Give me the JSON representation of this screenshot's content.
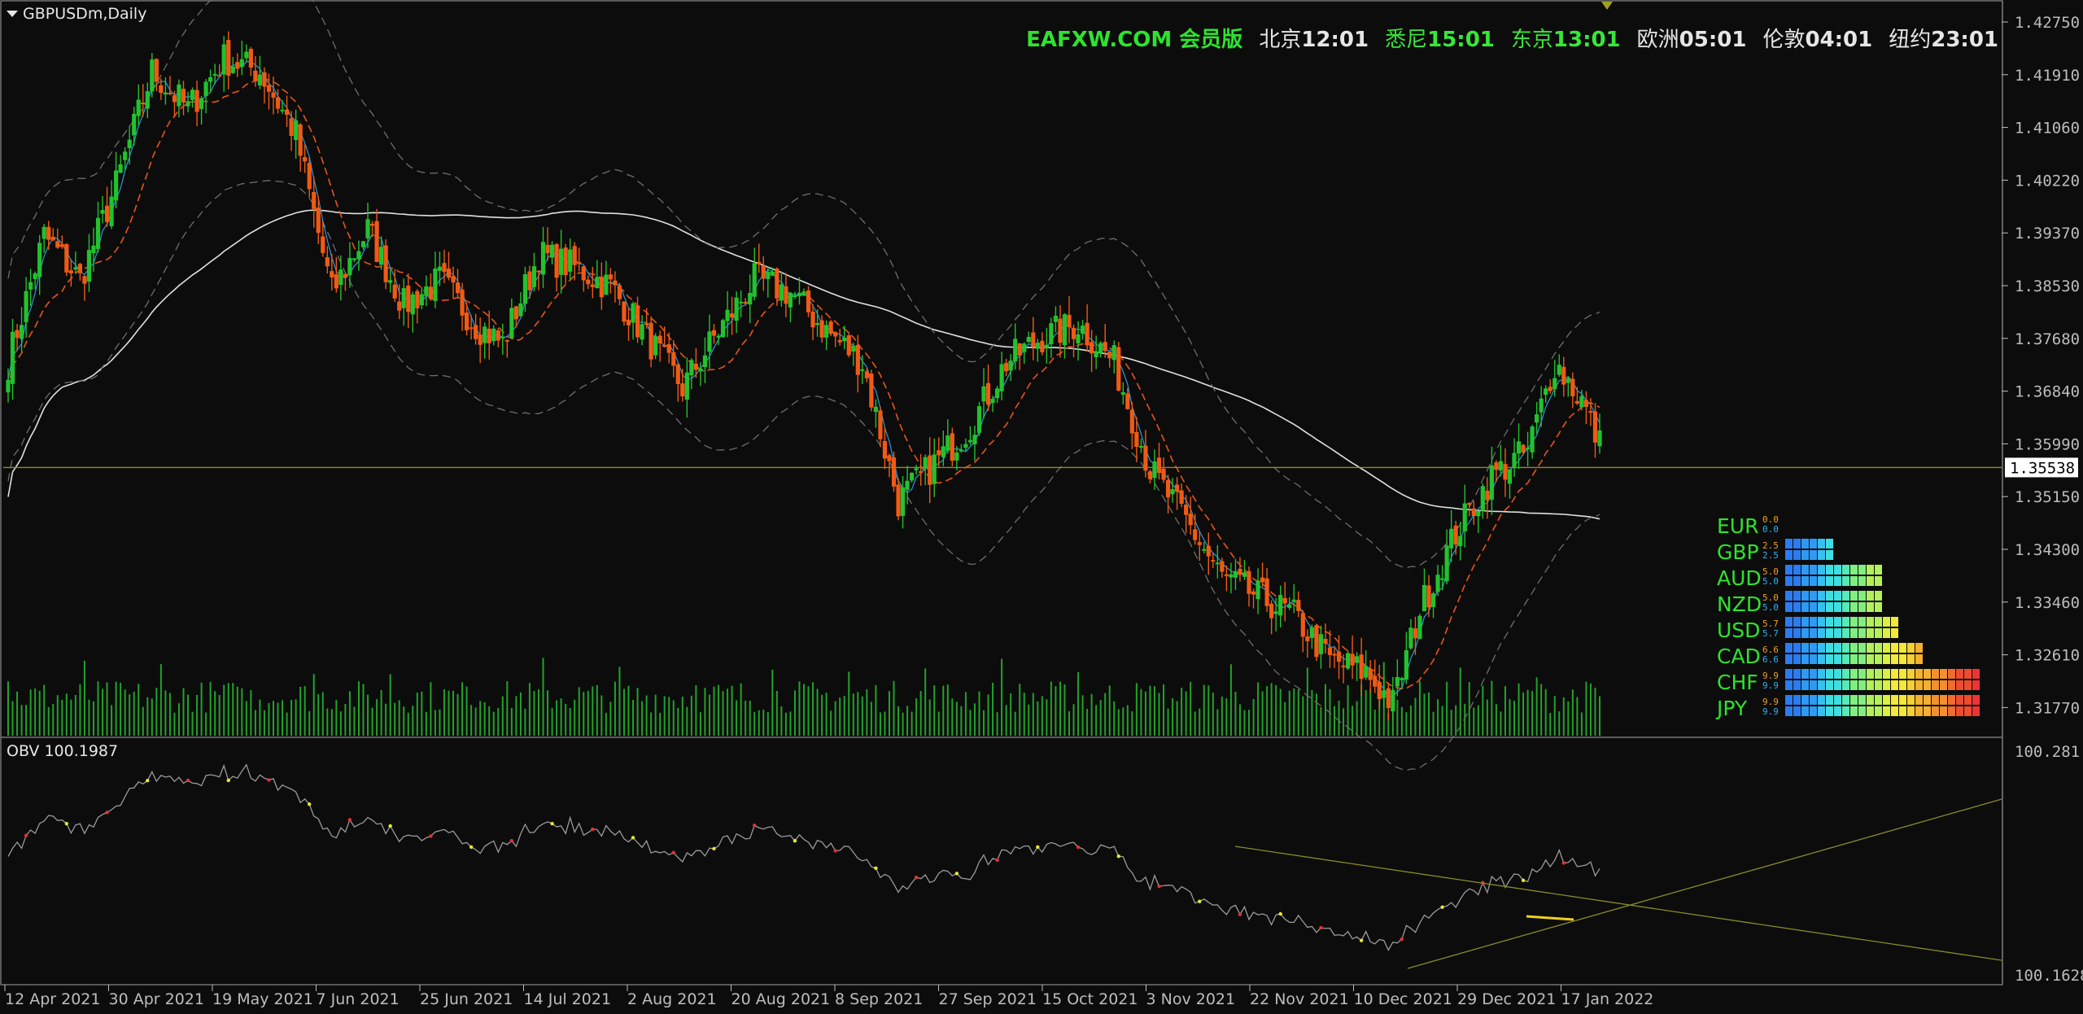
{
  "symbol": {
    "label": "GBPUSDm,Daily"
  },
  "header": {
    "brand": "EAFXW.COM 会员版",
    "clocks": [
      {
        "city": "北京",
        "time": "12:01",
        "color": "#e6e6e6"
      },
      {
        "city": "悉尼",
        "time": "15:01",
        "color": "#38e838"
      },
      {
        "city": "东京",
        "time": "13:01",
        "color": "#38e838"
      },
      {
        "city": "欧洲",
        "time": "05:01",
        "color": "#e6e6e6"
      },
      {
        "city": "伦敦",
        "time": "04:01",
        "color": "#e6e6e6"
      },
      {
        "city": "纽约",
        "time": "23:01",
        "color": "#e6e6e6"
      }
    ]
  },
  "colors": {
    "bull": "#22c22e",
    "bear": "#f05a14",
    "bg": "#0c0c0c",
    "grid_axis": "#bdbdbd",
    "current_line": "#8e8a2a",
    "sma200": "#e0e0e0",
    "ema": "#e8541a",
    "bands": "#6e6e6e",
    "obv_line": "#9a9a9a",
    "volume": "#22a22a"
  },
  "chart_data": [
    {
      "type": "candlestick",
      "title": "GBPUSDm,Daily",
      "price_ticks": [
        "1.42750",
        "1.41910",
        "1.41060",
        "1.40220",
        "1.39370",
        "1.38530",
        "1.37680",
        "1.36840",
        "1.35990",
        "1.35150",
        "1.34300",
        "1.33460",
        "1.32610",
        "1.31770"
      ],
      "current_price": "1.35538",
      "x_ticks": [
        "12 Apr 2021",
        "30 Apr 2021",
        "19 May 2021",
        "7 Jun 2021",
        "25 Jun 2021",
        "14 Jul 2021",
        "2 Aug 2021",
        "20 Aug 2021",
        "8 Sep 2021",
        "27 Sep 2021",
        "15 Oct 2021",
        "3 Nov 2021",
        "22 Nov 2021",
        "10 Dec 2021",
        "29 Dec 2021",
        "17 Jan 2022"
      ],
      "ylim": [
        1.313,
        1.429
      ],
      "path_keypoints": [
        [
          0,
          1.372
        ],
        [
          8,
          1.392
        ],
        [
          16,
          1.385
        ],
        [
          24,
          1.4
        ],
        [
          32,
          1.418
        ],
        [
          40,
          1.412
        ],
        [
          48,
          1.42
        ],
        [
          56,
          1.418
        ],
        [
          64,
          1.408
        ],
        [
          72,
          1.383
        ],
        [
          80,
          1.393
        ],
        [
          88,
          1.381
        ],
        [
          96,
          1.385
        ],
        [
          104,
          1.378
        ],
        [
          110,
          1.375
        ],
        [
          118,
          1.389
        ],
        [
          126,
          1.387
        ],
        [
          134,
          1.384
        ],
        [
          142,
          1.376
        ],
        [
          150,
          1.368
        ],
        [
          158,
          1.377
        ],
        [
          166,
          1.385
        ],
        [
          174,
          1.383
        ],
        [
          182,
          1.377
        ],
        [
          190,
          1.372
        ],
        [
          198,
          1.35
        ],
        [
          206,
          1.356
        ],
        [
          214,
          1.362
        ],
        [
          222,
          1.372
        ],
        [
          230,
          1.376
        ],
        [
          238,
          1.378
        ],
        [
          246,
          1.372
        ],
        [
          254,
          1.355
        ],
        [
          262,
          1.347
        ],
        [
          270,
          1.338
        ],
        [
          278,
          1.335
        ],
        [
          286,
          1.332
        ],
        [
          294,
          1.325
        ],
        [
          302,
          1.323
        ],
        [
          308,
          1.318
        ],
        [
          314,
          1.333
        ],
        [
          322,
          1.345
        ],
        [
          330,
          1.354
        ],
        [
          338,
          1.358
        ],
        [
          344,
          1.372
        ],
        [
          350,
          1.366
        ],
        [
          354,
          1.359
        ]
      ],
      "volume": {
        "type": "bar",
        "note": ""
      }
    },
    {
      "type": "line",
      "title": "OBV 100.1987",
      "y_ticks": [
        "100.281",
        "100.1628"
      ]
    }
  ],
  "currency_strength": [
    {
      "code": "EUR",
      "values": [
        "0.0",
        "0.0"
      ],
      "bars": 0
    },
    {
      "code": "GBP",
      "values": [
        "2.5",
        "2.5"
      ],
      "bars": 6
    },
    {
      "code": "AUD",
      "values": [
        "5.0",
        "5.0"
      ],
      "bars": 12
    },
    {
      "code": "NZD",
      "values": [
        "5.0",
        "5.0"
      ],
      "bars": 12
    },
    {
      "code": "USD",
      "values": [
        "5.7",
        "5.7"
      ],
      "bars": 14
    },
    {
      "code": "CAD",
      "values": [
        "6.6",
        "6.6"
      ],
      "bars": 17
    },
    {
      "code": "CHF",
      "values": [
        "9.9",
        "9.9"
      ],
      "bars": 24
    },
    {
      "code": "JPY",
      "values": [
        "9.9",
        "9.9"
      ],
      "bars": 24
    }
  ]
}
